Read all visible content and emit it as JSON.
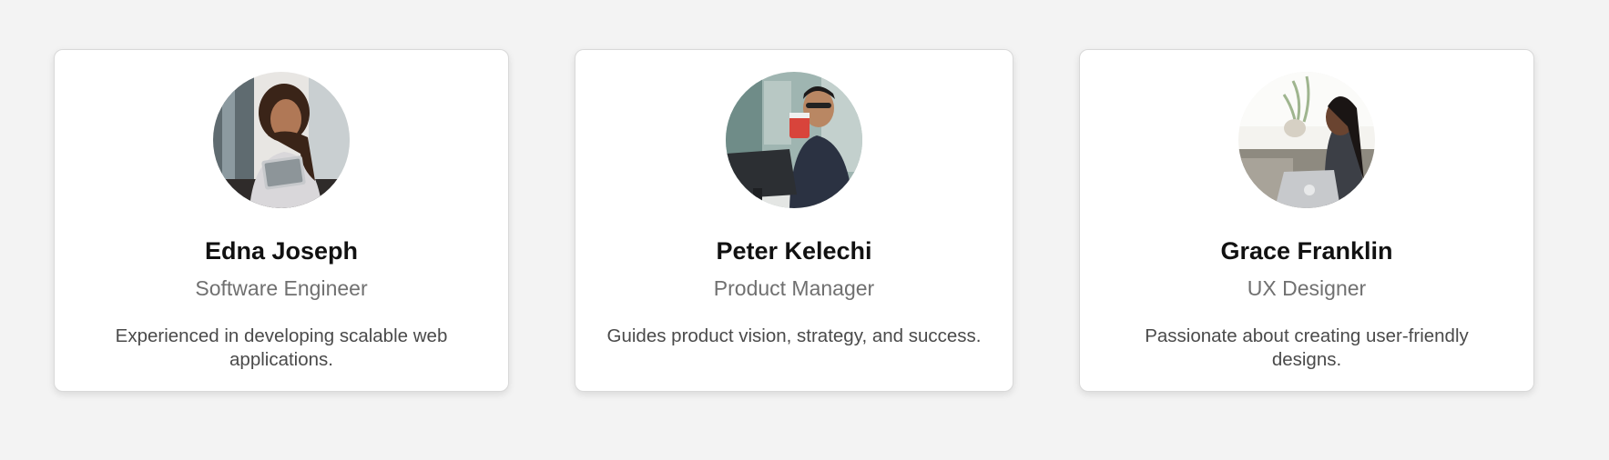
{
  "cards": [
    {
      "name": "Edna Joseph",
      "role": "Software Engineer",
      "bio": "Experienced in developing scalable web applications.",
      "photo": "woman-with-tablet-photo"
    },
    {
      "name": "Peter Kelechi",
      "role": "Product Manager",
      "bio": "Guides product vision, strategy, and success.",
      "photo": "man-drinking-coffee-photo"
    },
    {
      "name": "Grace Franklin",
      "role": "UX Designer",
      "bio": "Passionate about creating user-friendly designs.",
      "photo": "woman-with-laptop-photo"
    }
  ],
  "colors": {
    "background": "#f3f3f3",
    "card": "#ffffff",
    "name": "#111111",
    "role": "#707070",
    "bio": "#4a4a4a"
  }
}
